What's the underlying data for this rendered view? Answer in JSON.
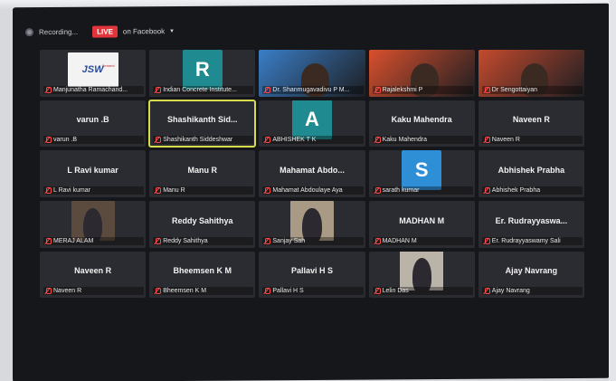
{
  "topbar": {
    "recording_label": "Recording...",
    "live_label": "LIVE",
    "stream_label": "on Facebook",
    "caret": "▾"
  },
  "tiles": [
    {
      "name": "",
      "label": "Manjunatha Ramachand...",
      "kind": "logo",
      "logo_text": "JSW",
      "logo_sub": "Cement"
    },
    {
      "name": "",
      "label": "Indian Concrete Institute...",
      "kind": "letter",
      "letter": "R",
      "letter_color": "#1f8a8f"
    },
    {
      "name": "",
      "label": "Dr. Shanmugavadivu P M...",
      "kind": "video",
      "bg": "#3a7ec7"
    },
    {
      "name": "",
      "label": "Rajalekshmi P",
      "kind": "video",
      "bg": "#d9502d"
    },
    {
      "name": "",
      "label": "Dr Sengottaiyan",
      "kind": "video",
      "bg": "#c44a2e"
    },
    {
      "name": "varun .B",
      "label": "varun .B",
      "kind": "text"
    },
    {
      "name": "Shashikanth Sid...",
      "label": "Shashikanth Siddeshwar",
      "kind": "text",
      "active": true
    },
    {
      "name": "",
      "label": "ABHISHEK T K",
      "kind": "letter",
      "letter": "A",
      "letter_color": "#1f8a8f"
    },
    {
      "name": "Kaku Mahendra",
      "label": "Kaku Mahendra",
      "kind": "text"
    },
    {
      "name": "Naveen R",
      "label": "Naveen R",
      "kind": "text"
    },
    {
      "name": "L Ravi kumar",
      "label": "L Ravi kumar",
      "kind": "text"
    },
    {
      "name": "Manu R",
      "label": "Manu R",
      "kind": "text"
    },
    {
      "name": "Mahamat Abdo...",
      "label": "Mahamat Abdoulaye Aya",
      "kind": "text"
    },
    {
      "name": "",
      "label": "sarath kumar",
      "kind": "letter",
      "letter": "S",
      "letter_color": "#2e8fd6"
    },
    {
      "name": "Abhishek Prabha",
      "label": "Abhishek Prabha",
      "kind": "text"
    },
    {
      "name": "",
      "label": "MERAJ ALAM",
      "kind": "photo",
      "bg": "#5b4b3e"
    },
    {
      "name": "Reddy Sahithya",
      "label": "Reddy Sahithya",
      "kind": "text"
    },
    {
      "name": "",
      "label": "Sanjay Sah",
      "kind": "photo",
      "bg": "#a89a85"
    },
    {
      "name": "MADHAN M",
      "label": "MADHAN M",
      "kind": "text"
    },
    {
      "name": "Er. Rudrayyaswa...",
      "label": "Er. Rudrayyaswamy Sali",
      "kind": "text"
    },
    {
      "name": "Naveen R",
      "label": "Naveen R",
      "kind": "text"
    },
    {
      "name": "Bheemsen K M",
      "label": "Bheemsen K M",
      "kind": "text"
    },
    {
      "name": "Pallavi H S",
      "label": "Pallavi H S",
      "kind": "text"
    },
    {
      "name": "",
      "label": "Lelin Das",
      "kind": "photo",
      "bg": "#b9b3a8"
    },
    {
      "name": "Ajay Navrang",
      "label": "Ajay Navrang",
      "kind": "text"
    }
  ]
}
